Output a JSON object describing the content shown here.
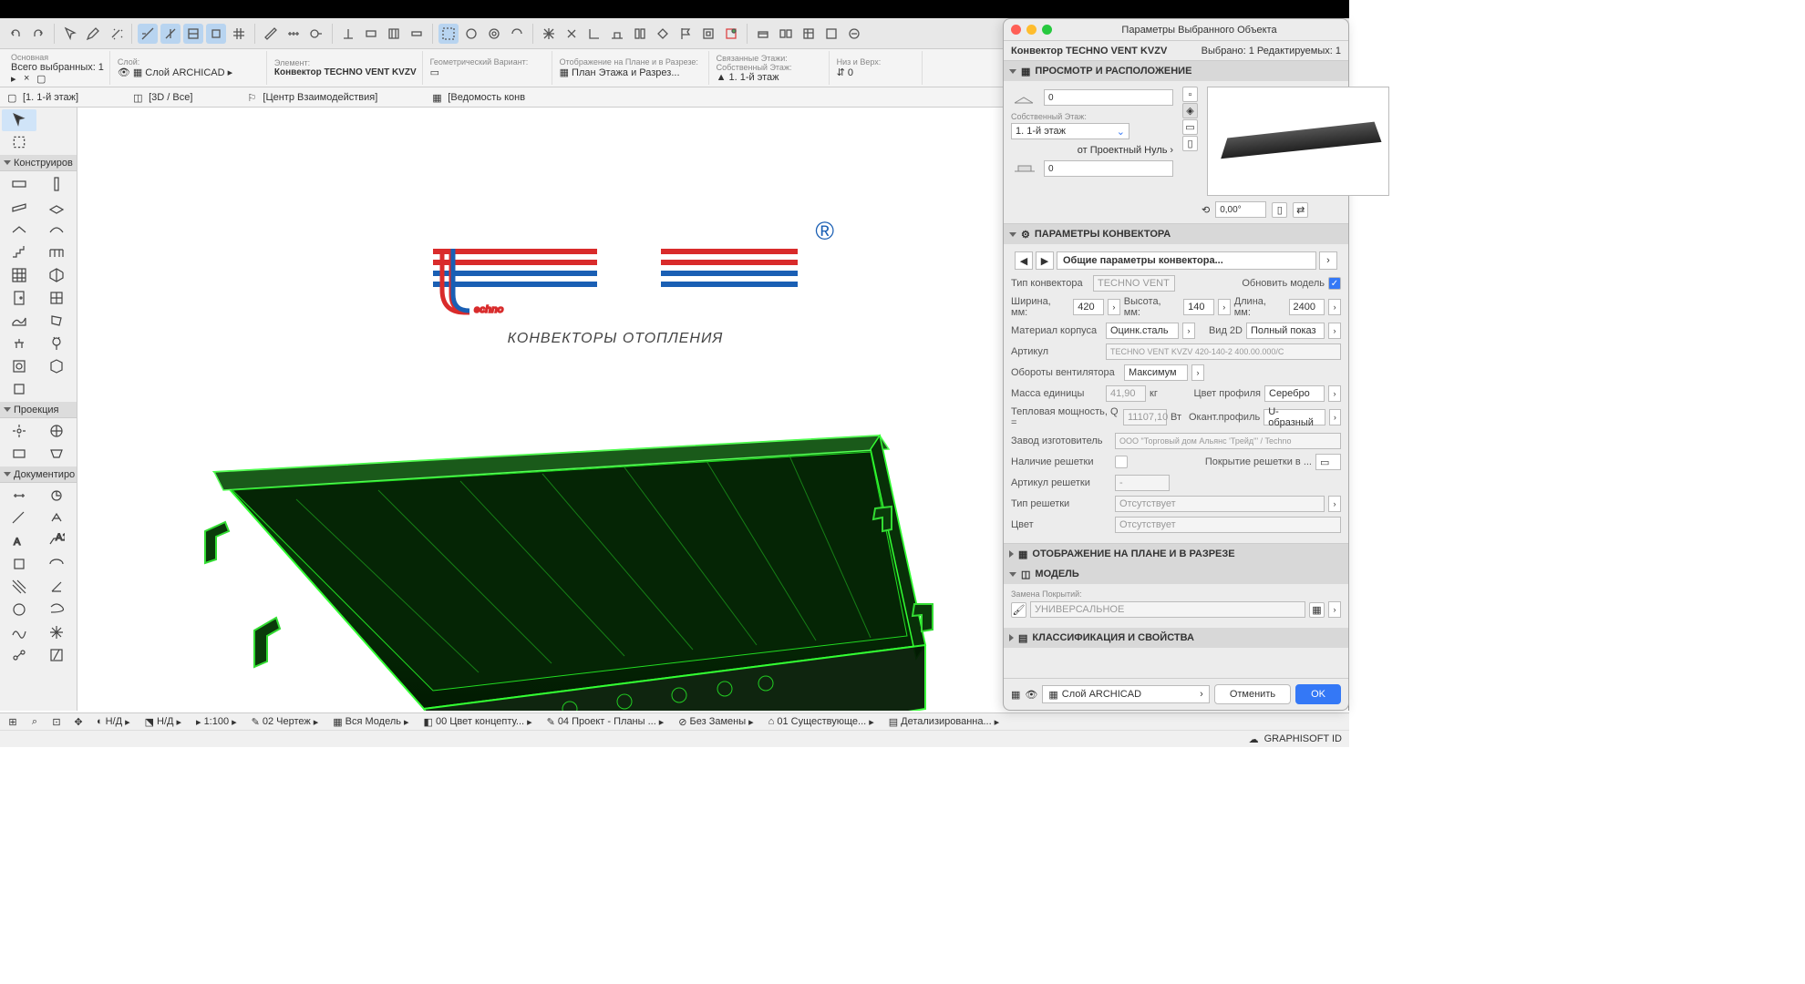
{
  "infobar": {
    "main_label": "Основная",
    "selection_label": "Всего выбранных:",
    "selection_count": "1",
    "layer_label": "Слой:",
    "layer_value": "Слой ARCHICAD",
    "element_label": "Элемент:",
    "element_value": "Конвектор TECHNO VENT KVZV",
    "geom_label": "Геометрический Вариант:",
    "section_label": "Отображение на Плане и в Разрезе:",
    "section_value": "План Этажа и Разрез...",
    "linked_label": "Связанные Этажи:",
    "linked_sub": "Собственный Этаж:",
    "linked_val": "1. 1-й этаж",
    "bottom_label": "Низ и Верх:",
    "bottom_val": "0"
  },
  "tabs": {
    "t1": "[1. 1-й этаж]",
    "t2": "[3D / Все]",
    "t3": "[Центр Взаимодействия]",
    "t4": "[Ведомость конв"
  },
  "leftpanels": {
    "p1": "Конструиров",
    "p2": "Проекция",
    "p3": "Документиро"
  },
  "logo": {
    "main": "Techno",
    "sub": "КОНВЕКТОРЫ ОТОПЛЕНИЯ",
    "r": "®"
  },
  "panel": {
    "title": "Параметры Выбранного Объекта",
    "name": "Конвектор TECHNO VENT KVZV",
    "seltxt": "Выбрано: 1 Редактируемых: 1",
    "sec1": "ПРОСМОТР И РАСПОЛОЖЕНИЕ",
    "z": "0",
    "floor_lbl": "Собственный Этаж:",
    "floor": "1. 1-й этаж",
    "ref_lbl": "от Проектный Нуль",
    "ref_chev": "›",
    "z2": "0",
    "rot": "0,00°",
    "sec2": "ПАРАМЕТРЫ КОНВЕКТОРА",
    "nav": "Общие параметры конвектора...",
    "type_lbl": "Тип конвектора",
    "type_val": "TECHNO VENT",
    "update_lbl": "Обновить модель",
    "w_lbl": "Ширина, мм:",
    "w": "420",
    "h_lbl": "Высота, мм:",
    "h": "140",
    "l_lbl": "Длина, мм:",
    "l": "2400",
    "mat_lbl": "Материал корпуса",
    "mat": "Оцинк.сталь",
    "view_lbl": "Вид 2D",
    "view": "Полный показ",
    "art_lbl": "Артикул",
    "art": "TECHNO VENT KVZV 420-140-2 400.00.000/С",
    "fan_lbl": "Обороты вентилятора",
    "fan": "Максимум",
    "mass_lbl": "Масса единицы",
    "mass": "41,90",
    "mass_u": "кг",
    "prof_lbl": "Цвет профиля",
    "prof": "Серебро",
    "pow_lbl": "Тепловая мощность, Q =",
    "pow": "11107,10",
    "pow_u": "Вт",
    "edge_lbl": "Окант.профиль",
    "edge": "U-образный",
    "mfr_lbl": "Завод изготовитель",
    "mfr": "ООО \"Торговый дом Альянс 'Трейд'\" / Techno",
    "grill_lbl": "Наличие решетки",
    "coat_lbl": "Покрытие решетки в ...",
    "gart_lbl": "Артикул решетки",
    "gart": "-",
    "gtype_lbl": "Тип решетки",
    "gtype": "Отсутствует",
    "color_lbl": "Цвет",
    "color": "Отсутствует",
    "sec3": "ОТОБРАЖЕНИЕ НА ПЛАНЕ И В РАЗРЕЗЕ",
    "sec4": "МОДЕЛЬ",
    "repl_lbl": "Замена Покрытий:",
    "repl_val": "УНИВЕРСАЛЬНОЕ",
    "sec5": "КЛАССИФИКАЦИЯ И СВОЙСТВА",
    "layer": "Слой ARCHICAD",
    "cancel": "Отменить",
    "ok": "OK"
  },
  "status": {
    "nd1": "Н/Д",
    "nd2": "Н/Д",
    "scale": "1:100",
    "s1": "02 Чертеж",
    "s2": "Вся Модель",
    "s3": "00 Цвет концепту...",
    "s4": "04 Проект - Планы ...",
    "s5": "Без Замены",
    "s6": "01 Существующе...",
    "s7": "Детализированна...",
    "gs": "GRAPHISOFT ID"
  }
}
